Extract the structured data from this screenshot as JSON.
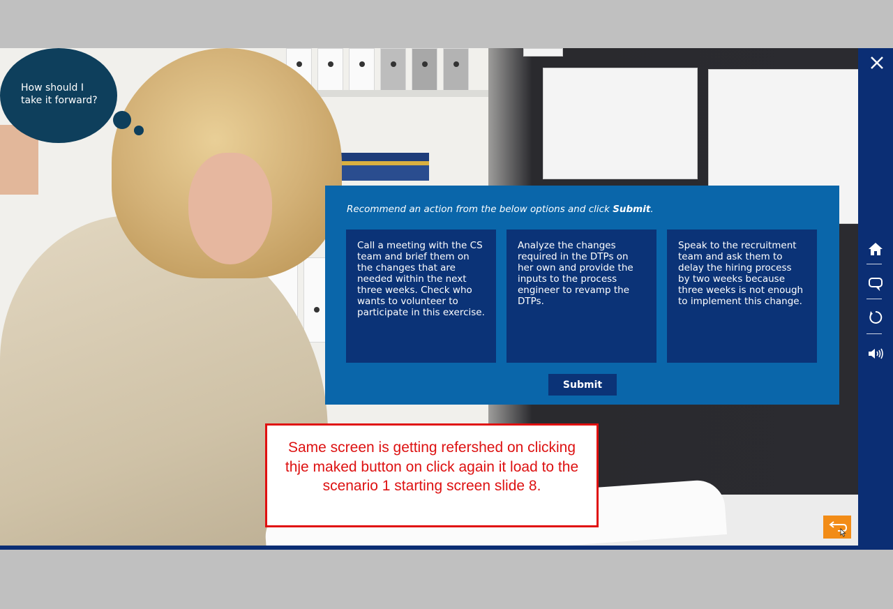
{
  "thought_bubble": {
    "text": "How should I take it forward?"
  },
  "quiz": {
    "instruction_prefix": "Recommend an action from the below options and click ",
    "instruction_bold": "Submit",
    "instruction_suffix": ".",
    "options": [
      "Call a meeting with the CS team and brief them on the changes that are needed within the next three weeks. Check who wants to volunteer to participate in this exercise.",
      "Analyze the changes required in the DTPs on her own and provide the inputs to the process engineer to revamp the DTPs.",
      "Speak to the recruitment team and ask them to delay the hiring process by two weeks because three weeks is not enough to implement this change."
    ],
    "submit_label": "Submit"
  },
  "annotation": {
    "text": "Same screen is getting refershed on clicking thje maked button on click again it load to the scenario 1 starting screen slide 8."
  },
  "nav": {
    "icons": [
      "close-icon",
      "home-icon",
      "comment-icon",
      "replay-icon",
      "volume-icon",
      "back-icon"
    ]
  },
  "colors": {
    "panel": "#0a66aa",
    "option": "#0b3377",
    "sidebar": "#0b2e74",
    "bubble": "#0e3f5c",
    "back_button": "#f28c17",
    "annotation": "#e01010"
  }
}
